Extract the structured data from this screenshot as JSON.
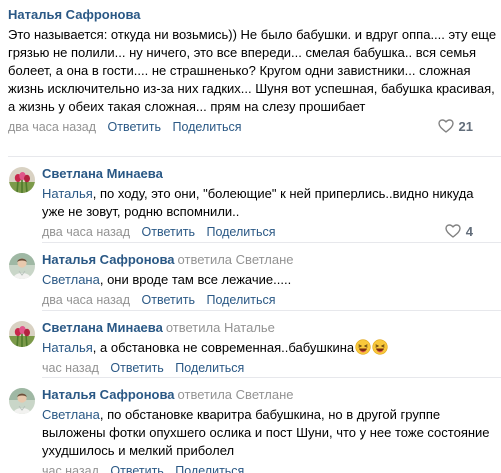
{
  "comments": [
    {
      "author": "Наталья Сафронова",
      "text": "Это называется: откуда ни возьмись)) Не было бабушки. и вдруг оппа.... эту еще грязью не полили... ну ничего, это все впереди... смелая бабушка.. вся семья болеет, а она в гости.... не страшненько? Кругом одни завистники... сложная жизнь исключительно из-за них гадких... Шуня вот успешная, бабушка красивая, а жизнь у обеих такая сложная... прям на слезу прошибает",
      "time": "два часа назад",
      "reply_label": "Ответить",
      "share_label": "Поделиться",
      "likes": "21"
    },
    {
      "author": "Светлана Минаева",
      "mention": "Наталья",
      "text": ", по ходу, это они, \"болеющие\" к ней приперлись..видно никуда уже не зовут, родню вспомнили..",
      "time": "два часа назад",
      "reply_label": "Ответить",
      "share_label": "Поделиться",
      "likes": "4"
    },
    {
      "author": "Наталья Сафронова",
      "reply_to_word": "ответила",
      "reply_to_name": "Светлане",
      "mention": "Светлана",
      "text": ", они вроде там все лежачие.....",
      "time": "два часа назад",
      "reply_label": "Ответить",
      "share_label": "Поделиться"
    },
    {
      "author": "Светлана Минаева",
      "reply_to_word": "ответила",
      "reply_to_name": "Наталье",
      "mention": "Наталья",
      "text": ", а обстановка не современная..бабушкина",
      "emojis": [
        "laughing-emoji",
        "laughing-emoji"
      ],
      "time": "час назад",
      "reply_label": "Ответить",
      "share_label": "Поделиться"
    },
    {
      "author": "Наталья Сафронова",
      "reply_to_word": "ответила",
      "reply_to_name": "Светлане",
      "mention": "Светлана",
      "text": ", по обстановке кваритра бабушкина, но в другой группе выложены фотки опухшего ослика и пост Шуни, что у нее тоже состояние ухудшилось и мелкий приболел",
      "time": "час назад",
      "reply_label": "Ответить",
      "share_label": "Поделиться"
    }
  ],
  "icons": {
    "like": "heart-icon",
    "avatar_svetlana": "tulips-avatar",
    "avatar_natalia": "portrait-avatar"
  },
  "colors": {
    "link": "#2a5885",
    "muted": "#939393",
    "divider": "#e7e8ec"
  }
}
